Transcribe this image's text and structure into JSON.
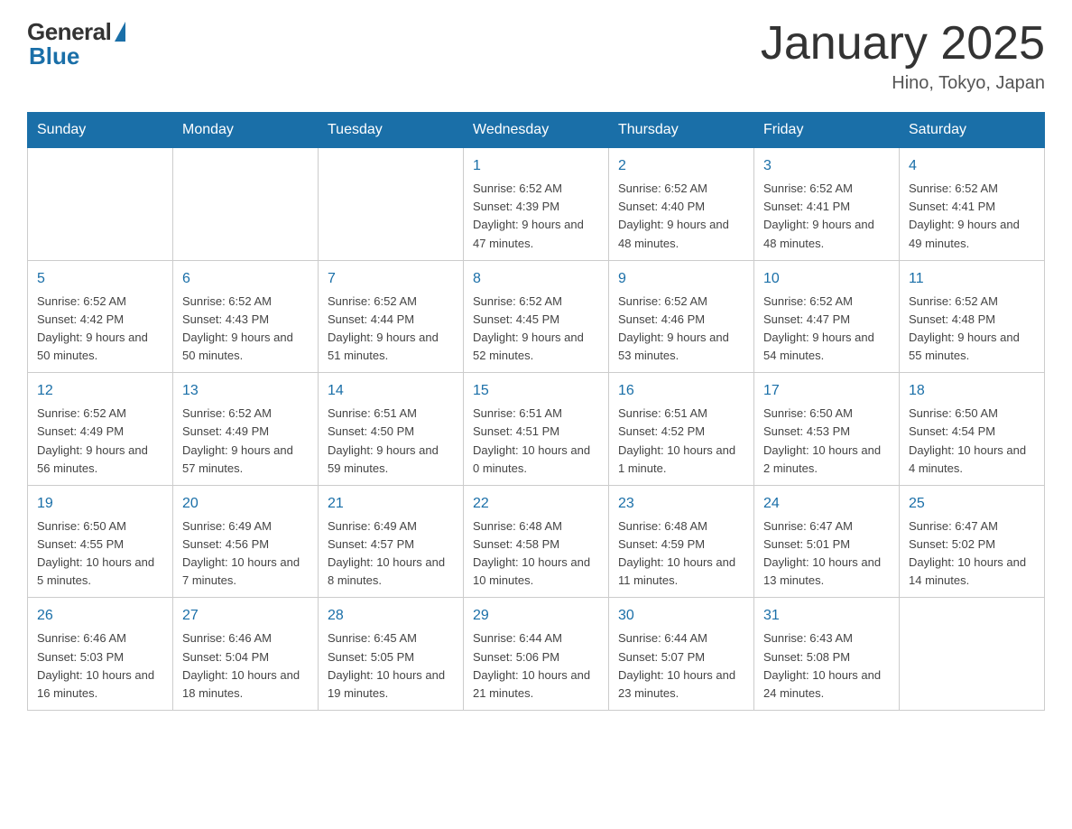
{
  "header": {
    "logo_general": "General",
    "logo_blue": "Blue",
    "month_title": "January 2025",
    "location": "Hino, Tokyo, Japan"
  },
  "days_of_week": [
    "Sunday",
    "Monday",
    "Tuesday",
    "Wednesday",
    "Thursday",
    "Friday",
    "Saturday"
  ],
  "weeks": [
    [
      {
        "day": "",
        "info": ""
      },
      {
        "day": "",
        "info": ""
      },
      {
        "day": "",
        "info": ""
      },
      {
        "day": "1",
        "info": "Sunrise: 6:52 AM\nSunset: 4:39 PM\nDaylight: 9 hours and 47 minutes."
      },
      {
        "day": "2",
        "info": "Sunrise: 6:52 AM\nSunset: 4:40 PM\nDaylight: 9 hours and 48 minutes."
      },
      {
        "day": "3",
        "info": "Sunrise: 6:52 AM\nSunset: 4:41 PM\nDaylight: 9 hours and 48 minutes."
      },
      {
        "day": "4",
        "info": "Sunrise: 6:52 AM\nSunset: 4:41 PM\nDaylight: 9 hours and 49 minutes."
      }
    ],
    [
      {
        "day": "5",
        "info": "Sunrise: 6:52 AM\nSunset: 4:42 PM\nDaylight: 9 hours and 50 minutes."
      },
      {
        "day": "6",
        "info": "Sunrise: 6:52 AM\nSunset: 4:43 PM\nDaylight: 9 hours and 50 minutes."
      },
      {
        "day": "7",
        "info": "Sunrise: 6:52 AM\nSunset: 4:44 PM\nDaylight: 9 hours and 51 minutes."
      },
      {
        "day": "8",
        "info": "Sunrise: 6:52 AM\nSunset: 4:45 PM\nDaylight: 9 hours and 52 minutes."
      },
      {
        "day": "9",
        "info": "Sunrise: 6:52 AM\nSunset: 4:46 PM\nDaylight: 9 hours and 53 minutes."
      },
      {
        "day": "10",
        "info": "Sunrise: 6:52 AM\nSunset: 4:47 PM\nDaylight: 9 hours and 54 minutes."
      },
      {
        "day": "11",
        "info": "Sunrise: 6:52 AM\nSunset: 4:48 PM\nDaylight: 9 hours and 55 minutes."
      }
    ],
    [
      {
        "day": "12",
        "info": "Sunrise: 6:52 AM\nSunset: 4:49 PM\nDaylight: 9 hours and 56 minutes."
      },
      {
        "day": "13",
        "info": "Sunrise: 6:52 AM\nSunset: 4:49 PM\nDaylight: 9 hours and 57 minutes."
      },
      {
        "day": "14",
        "info": "Sunrise: 6:51 AM\nSunset: 4:50 PM\nDaylight: 9 hours and 59 minutes."
      },
      {
        "day": "15",
        "info": "Sunrise: 6:51 AM\nSunset: 4:51 PM\nDaylight: 10 hours and 0 minutes."
      },
      {
        "day": "16",
        "info": "Sunrise: 6:51 AM\nSunset: 4:52 PM\nDaylight: 10 hours and 1 minute."
      },
      {
        "day": "17",
        "info": "Sunrise: 6:50 AM\nSunset: 4:53 PM\nDaylight: 10 hours and 2 minutes."
      },
      {
        "day": "18",
        "info": "Sunrise: 6:50 AM\nSunset: 4:54 PM\nDaylight: 10 hours and 4 minutes."
      }
    ],
    [
      {
        "day": "19",
        "info": "Sunrise: 6:50 AM\nSunset: 4:55 PM\nDaylight: 10 hours and 5 minutes."
      },
      {
        "day": "20",
        "info": "Sunrise: 6:49 AM\nSunset: 4:56 PM\nDaylight: 10 hours and 7 minutes."
      },
      {
        "day": "21",
        "info": "Sunrise: 6:49 AM\nSunset: 4:57 PM\nDaylight: 10 hours and 8 minutes."
      },
      {
        "day": "22",
        "info": "Sunrise: 6:48 AM\nSunset: 4:58 PM\nDaylight: 10 hours and 10 minutes."
      },
      {
        "day": "23",
        "info": "Sunrise: 6:48 AM\nSunset: 4:59 PM\nDaylight: 10 hours and 11 minutes."
      },
      {
        "day": "24",
        "info": "Sunrise: 6:47 AM\nSunset: 5:01 PM\nDaylight: 10 hours and 13 minutes."
      },
      {
        "day": "25",
        "info": "Sunrise: 6:47 AM\nSunset: 5:02 PM\nDaylight: 10 hours and 14 minutes."
      }
    ],
    [
      {
        "day": "26",
        "info": "Sunrise: 6:46 AM\nSunset: 5:03 PM\nDaylight: 10 hours and 16 minutes."
      },
      {
        "day": "27",
        "info": "Sunrise: 6:46 AM\nSunset: 5:04 PM\nDaylight: 10 hours and 18 minutes."
      },
      {
        "day": "28",
        "info": "Sunrise: 6:45 AM\nSunset: 5:05 PM\nDaylight: 10 hours and 19 minutes."
      },
      {
        "day": "29",
        "info": "Sunrise: 6:44 AM\nSunset: 5:06 PM\nDaylight: 10 hours and 21 minutes."
      },
      {
        "day": "30",
        "info": "Sunrise: 6:44 AM\nSunset: 5:07 PM\nDaylight: 10 hours and 23 minutes."
      },
      {
        "day": "31",
        "info": "Sunrise: 6:43 AM\nSunset: 5:08 PM\nDaylight: 10 hours and 24 minutes."
      },
      {
        "day": "",
        "info": ""
      }
    ]
  ]
}
